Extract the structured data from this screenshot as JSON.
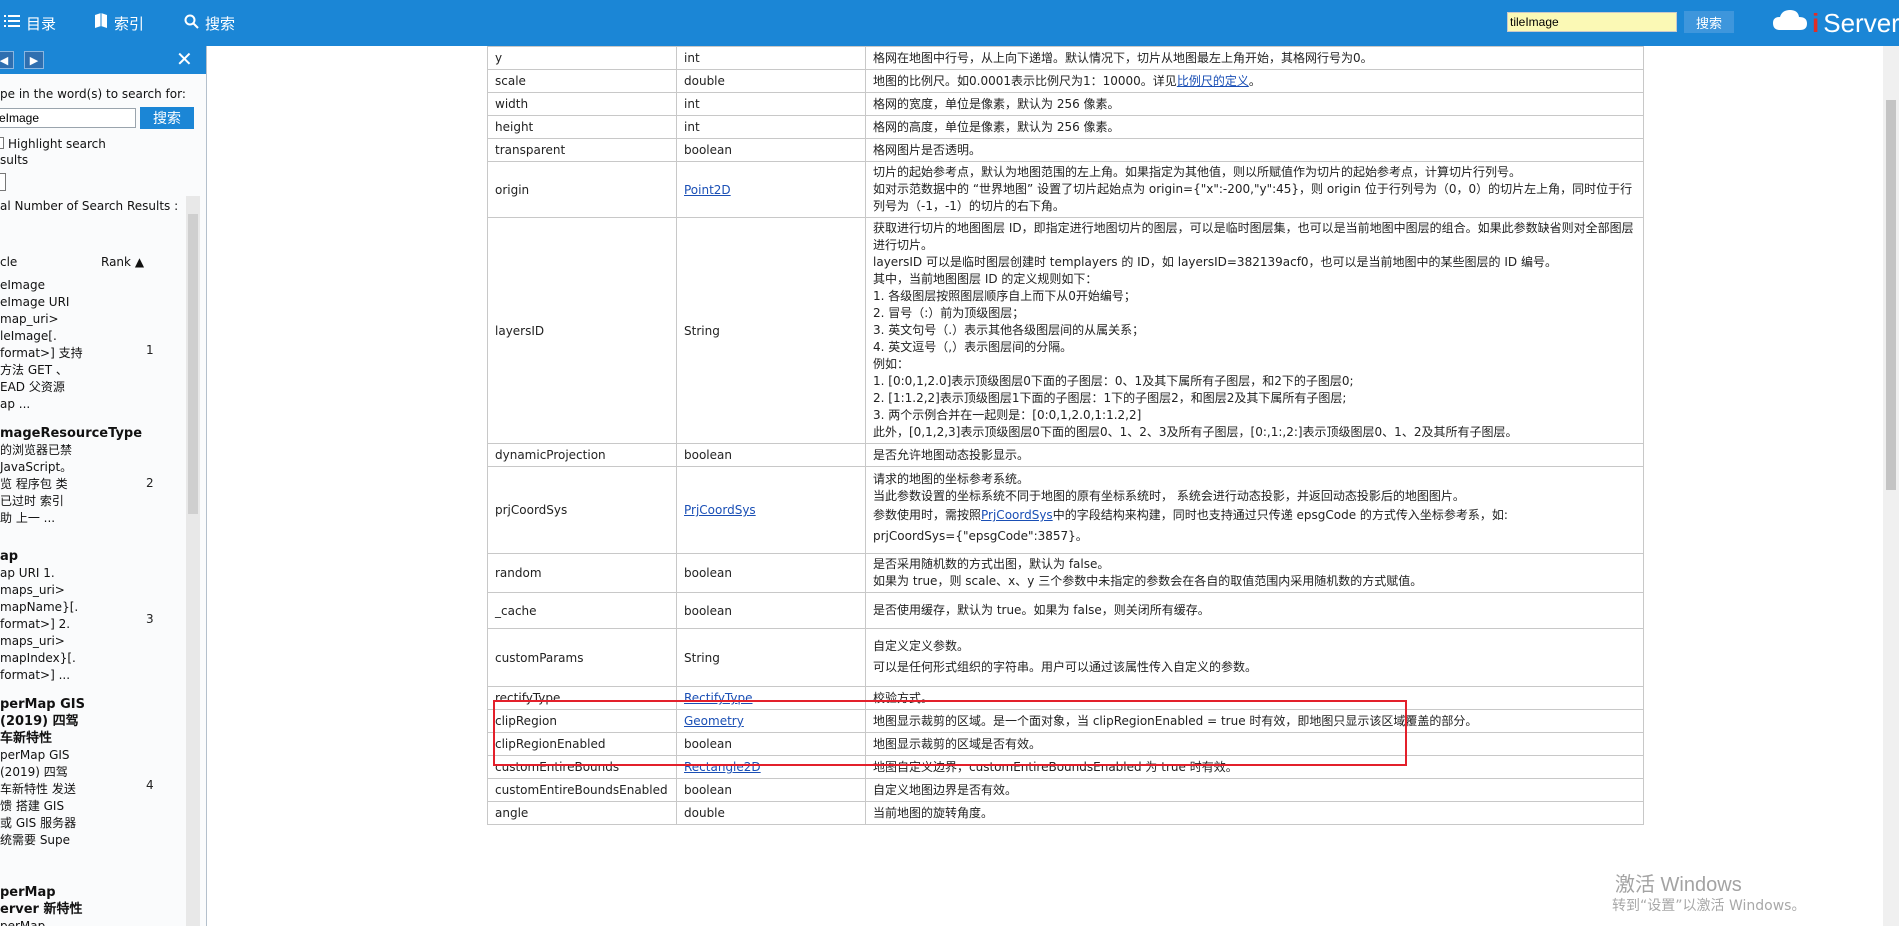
{
  "topbar": {
    "contents_label": "目录",
    "index_label": "索引",
    "search_label": "搜索",
    "search_value": "tileImage",
    "search_button": "搜索",
    "logo_text": "Server",
    "logo_prefix": "i"
  },
  "sidebar": {
    "prompt": "pe in the word(s) to search for:",
    "search_value": "eImage",
    "search_button": "搜索",
    "highlight_label": "Highlight search",
    "highlight_label2": "sults",
    "total_label": "al Number of Search Results :",
    "col_title": "cle",
    "col_rank": "Rank",
    "results": [
      {
        "lines": [
          "eImage",
          "eImage URI",
          "map_uri>",
          "leImage[.",
          "format>] 支持",
          "方法 GET 、",
          "EAD 父资源",
          "ap ..."
        ],
        "rank": "1"
      },
      {
        "lines": [
          "mageResourceType",
          "的浏览器已禁",
          "JavaScript。",
          "览 程序包 类",
          "已过时 索引",
          "助 上一 ..."
        ],
        "rank": "2"
      },
      {
        "lines": [
          "ap",
          "ap URI 1.",
          "maps_uri>",
          "mapName}[.",
          "format>] 2.",
          "maps_uri>",
          "mapIndex}[.",
          "format>] ..."
        ],
        "rank": "3"
      },
      {
        "lines": [
          "perMap GIS",
          "(2019) 四驾",
          "车新特性",
          "perMap GIS",
          "(2019) 四驾",
          "车新特性 发送",
          "馈 搭建 GIS",
          "或 GIS 服务器",
          "统需要 Supe"
        ],
        "rank": "4"
      },
      {
        "lines": [
          "perMap",
          "erver 新特性",
          "perMap"
        ],
        "rank": ""
      }
    ]
  },
  "table": {
    "rows": [
      {
        "name": "y",
        "type": "int",
        "type_link": false,
        "desc": [
          "格网在地图中行号，从上向下递增。默认情况下，切片从地图最左上角开始，其格网行号为0。"
        ]
      },
      {
        "name": "scale",
        "type": "double",
        "type_link": false,
        "desc": [
          "地图的比例尺。如0.0001表示比例尺为1：10000。详见比例尺的定义。"
        ]
      },
      {
        "name": "width",
        "type": "int",
        "type_link": false,
        "desc": [
          "格网的宽度，单位是像素，默认为 256 像素。"
        ]
      },
      {
        "name": "height",
        "type": "int",
        "type_link": false,
        "desc": [
          "格网的高度，单位是像素，默认为 256 像素。"
        ]
      },
      {
        "name": "transparent",
        "type": "boolean",
        "type_link": false,
        "desc": [
          "格网图片是否透明。"
        ]
      },
      {
        "name": "origin",
        "type": "Point2D",
        "type_link": true,
        "desc": [
          "切片的起始参考点，默认为地图范围的左上角。如果指定为其他值，则以所赋值作为切片的起始参考点，计算切片行列号。",
          "如对示范数据中的 “世界地图” 设置了切片起始点为 origin={\"x\":-200,\"y\":45}，则 origin 位于行列号为（0，0）的切片左上角，同时位于行列号为（-1，-1）的切片的右下角。"
        ]
      },
      {
        "name": "layersID",
        "type": "String",
        "type_link": false,
        "desc": [
          "获取进行切片的地图图层 ID，即指定进行地图切片的图层，可以是临时图层集，也可以是当前地图中图层的组合。如果此参数缺省则对全部图层进行切片。",
          "layersID 可以是临时图层创建时 templayers 的 ID，如 layersID=382139acf0，也可以是当前地图中的某些图层的 ID 编号。",
          "其中，当前地图图层 ID 的定义规则如下：",
          "1. 各级图层按照图层顺序自上而下从0开始编号；",
          "2. 冒号（:）前为顶级图层；",
          "3. 英文句号（.）表示其他各级图层间的从属关系；",
          "4. 英文逗号（,）表示图层间的分隔。",
          "例如：",
          "1. [0:0,1,2.0]表示顶级图层0下面的子图层：0、1及其下属所有子图层，和2下的子图层0;",
          "2. [1:1.2,2]表示顶级图层1下面的子图层：1下的子图层2，和图层2及其下属所有子图层;",
          "3. 两个示例合并在一起则是：[0:0,1,2.0,1:1.2,2]",
          "此外，[0,1,2,3]表示顶级图层0下面的图层0、1、2、3及所有子图层，[0:,1:,2:]表示顶级图层0、1、2及其所有子图层。"
        ]
      },
      {
        "name": "dynamicProjection",
        "type": "boolean",
        "type_link": false,
        "desc": [
          "是否允许地图动态投影显示。"
        ]
      },
      {
        "name": "prjCoordSys",
        "type": "PrjCoordSys",
        "type_link": true,
        "desc": [
          "请求的地图的坐标参考系统。",
          "当此参数设置的坐标系统不同于地图的原有坐标系统时， 系统会进行动态投影，并返回动态投影后的地图图片。",
          "参数使用时，需按照PrjCoordSys中的字段结构来构建，同时也支持通过只传递 epsgCode 的方式传入坐标参考系，如:",
          "prjCoordSys={\"epsgCode\":3857}。"
        ]
      },
      {
        "name": "random",
        "type": "boolean",
        "type_link": false,
        "desc": [
          "是否采用随机数的方式出图，默认为 false。",
          "如果为 true，则 scale、x、y 三个参数中未指定的参数会在各自的取值范围内采用随机数的方式赋值。"
        ]
      },
      {
        "name": "_cache",
        "type": "boolean",
        "type_link": false,
        "desc": [
          "是否使用缓存，默认为 true。如果为 false，则关闭所有缓存。"
        ]
      },
      {
        "name": "customParams",
        "type": "String",
        "type_link": false,
        "desc": [
          "自定义定义参数。",
          "可以是任何形式组织的字符串。用户可以通过该属性传入自定义的参数。"
        ]
      },
      {
        "name": "rectifyType",
        "type": "RectifyType",
        "type_link": true,
        "desc": [
          "校验方式。"
        ]
      },
      {
        "name": "clipRegion",
        "type": "Geometry",
        "type_link": true,
        "desc": [
          "地图显示裁剪的区域。是一个面对象，当 clipRegionEnabled = true 时有效，即地图只显示该区域覆盖的部分。"
        ]
      },
      {
        "name": "clipRegionEnabled",
        "type": "boolean",
        "type_link": false,
        "desc": [
          "地图显示裁剪的区域是否有效。"
        ]
      },
      {
        "name": "customEntireBounds",
        "type": "Rectangle2D",
        "type_link": true,
        "desc": [
          "地图自定义边界，customEntireBoundsEnabled 为 true 时有效。"
        ]
      },
      {
        "name": "customEntireBoundsEnabled",
        "type": "boolean",
        "type_link": false,
        "desc": [
          "自定义地图边界是否有效。"
        ]
      },
      {
        "name": "angle",
        "type": "double",
        "type_link": false,
        "desc": [
          "当前地图的旋转角度。"
        ]
      }
    ]
  },
  "watermark": {
    "line1": "激活 Windows",
    "line2": "转到“设置”以激活 Windows。"
  },
  "colors": {
    "topbar": "#1b86d6",
    "highlight_box": "#e3202b",
    "link": "#1a4fb5"
  }
}
